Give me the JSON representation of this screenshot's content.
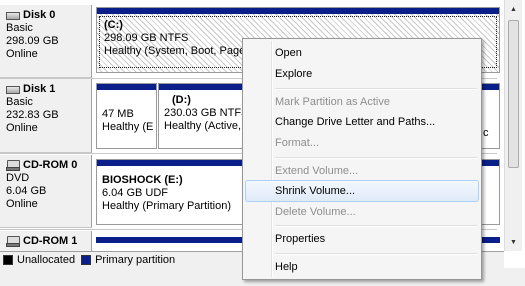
{
  "disks": [
    {
      "name": "Disk 0",
      "type": "Basic",
      "size": "298.09 GB",
      "status": "Online",
      "icon": "disk-icon"
    },
    {
      "name": "Disk 1",
      "type": "Basic",
      "size": "232.83 GB",
      "status": "Online",
      "icon": "disk-icon"
    },
    {
      "name": "CD-ROM 0",
      "type": "DVD",
      "size": "6.04 GB",
      "status": "Online",
      "icon": "cd-icon"
    },
    {
      "name": "CD-ROM 1",
      "icon": "cd-icon"
    }
  ],
  "partitions": {
    "disk0_c": {
      "label": "(C:)",
      "line2": "298.09 GB NTFS",
      "line3": "Healthy (System, Boot, Page"
    },
    "disk1_p1": {
      "line2": "47 MB",
      "line3": "Healthy (E"
    },
    "disk1_d": {
      "label": "(D:)",
      "line2": "230.03 GB NTFS",
      "line3": "Healthy (Active,"
    },
    "disk1_tail": {
      "line3": "c"
    },
    "cdrom0": {
      "label": "BIOSHOCK  (E:)",
      "line2": "6.04 GB UDF",
      "line3": "Healthy (Primary Partition)"
    }
  },
  "legend": [
    {
      "label": "Unallocated",
      "color": "#000000"
    },
    {
      "label": "Primary partition",
      "color": "#0a1f8a"
    }
  ],
  "menu": {
    "open": "Open",
    "explore": "Explore",
    "mark_active": "Mark Partition as Active",
    "change_letter": "Change Drive Letter and Paths...",
    "format": "Format...",
    "extend": "Extend Volume...",
    "shrink": "Shrink Volume...",
    "delete": "Delete Volume...",
    "properties": "Properties",
    "help": "Help"
  },
  "colors": {
    "primary": "#0a1f8a",
    "unallocated": "#000000",
    "highlight": "#dfeaf8"
  }
}
